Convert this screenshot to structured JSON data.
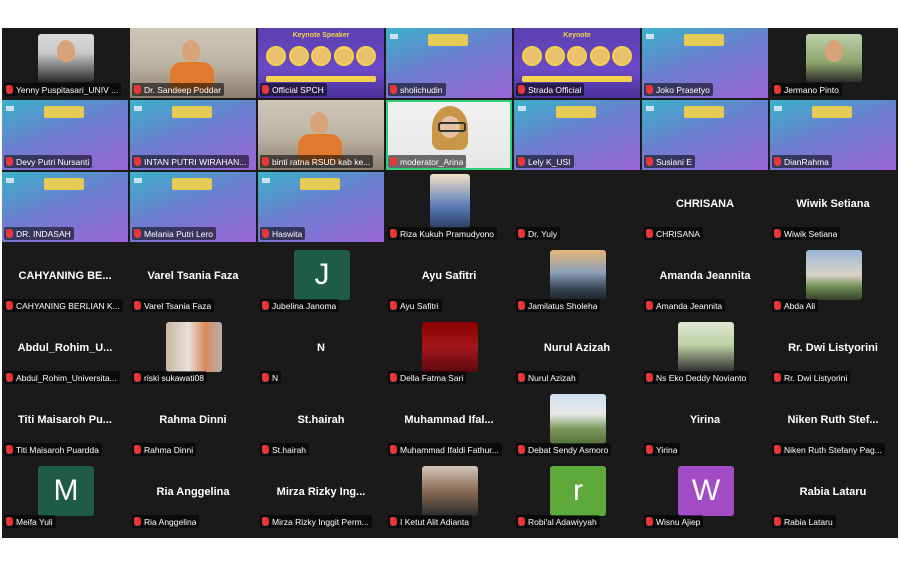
{
  "colors": {
    "accent_active": "#2fd07a",
    "muted_mic": "#e03a3a",
    "grid_bg": "#1a1a1a"
  },
  "participants": [
    {
      "name": "Yenny Puspitasari_UNIV ...",
      "bg": "woman-photo"
    },
    {
      "name": "Dr. Sandeep Poddar",
      "bg": "room-photo"
    },
    {
      "name": "Official SPCH",
      "bg": "poster",
      "heading": "Keynote Speaker"
    },
    {
      "name": "sholichudin",
      "bg": "purple"
    },
    {
      "name": "Strada Official",
      "bg": "poster",
      "heading": "Keynote"
    },
    {
      "name": "Joko Prasetyo",
      "bg": "purple"
    },
    {
      "name": "Jermano Pinto",
      "bg": "man-photo"
    },
    {
      "name": "Devy Putri Nursanti",
      "bg": "purple"
    },
    {
      "name": "INTAN PUTRI WIRAHAN...",
      "bg": "purple"
    },
    {
      "name": "binti ratna RSUD kab ke...",
      "bg": "room-photo"
    },
    {
      "name": "moderator_Arina",
      "bg": "hijab",
      "active": true
    },
    {
      "name": "Lely K_USI",
      "bg": "purple"
    },
    {
      "name": "Susiani E",
      "bg": "purple"
    },
    {
      "name": "DianRahma",
      "bg": "purple"
    },
    {
      "name": "DR. INDASAH",
      "bg": "purple"
    },
    {
      "name": "Melania Putri Lero",
      "bg": "purple"
    },
    {
      "name": "Haswita",
      "bg": "purple"
    },
    {
      "name": "Riza Kukuh Pramudyono",
      "bg": "cartoon"
    },
    {
      "name": "Dr. Yuly",
      "bg": "dark"
    },
    {
      "name": "CHRISANA",
      "bg": "dark",
      "label": "CHRISANA"
    },
    {
      "name": "Wiwik Setiana",
      "bg": "dark",
      "label": "Wiwik Setiana"
    },
    {
      "name": "CAHYANING BERLIAN K...",
      "bg": "dark",
      "label": "CAHYANING BE..."
    },
    {
      "name": "Varel Tsania Faza",
      "bg": "dark",
      "label": "Varel Tsania Faza"
    },
    {
      "name": "Jubelina Janoma",
      "bg": "initial",
      "initial": "J",
      "color": "#1f5b49"
    },
    {
      "name": "Ayu Safitri",
      "bg": "dark",
      "label": "Ayu Safitri"
    },
    {
      "name": "Jamilatus Sholeha",
      "bg": "sunset"
    },
    {
      "name": "Amanda Jeannita",
      "bg": "dark",
      "label": "Amanda Jeannita"
    },
    {
      "name": "Abda Ali",
      "bg": "mountain"
    },
    {
      "name": "Abdul_Rohim_Universita...",
      "bg": "dark",
      "label": "Abdul_Rohim_U..."
    },
    {
      "name": "riski sukawati08",
      "bg": "shelf"
    },
    {
      "name": "N",
      "bg": "dark",
      "label": "N"
    },
    {
      "name": "Della Fatma Sari",
      "bg": "redphoto"
    },
    {
      "name": "Nurul Azizah",
      "bg": "dark",
      "label": "Nurul Azizah"
    },
    {
      "name": "Ns Eko Deddy Novianto",
      "bg": "portrait-man"
    },
    {
      "name": "Rr. Dwi Listyorini",
      "bg": "dark",
      "label": "Rr. Dwi Listyorini"
    },
    {
      "name": "Titi Maisaroh Puardda",
      "bg": "dark",
      "label": "Titi Maisaroh Pu..."
    },
    {
      "name": "Rahma Dinni",
      "bg": "dark",
      "label": "Rahma Dinni"
    },
    {
      "name": "St.hairah",
      "bg": "dark",
      "label": "St.hairah"
    },
    {
      "name": "Muhammad Ifaldi Fathur...",
      "bg": "dark",
      "label": "Muhammad Ifal..."
    },
    {
      "name": "Debat Sendy Asmoro",
      "bg": "park"
    },
    {
      "name": "Yirina",
      "bg": "dark",
      "label": "Yirina"
    },
    {
      "name": "Niken Ruth Stefany Pag...",
      "bg": "dark",
      "label": "Niken Ruth Stef..."
    },
    {
      "name": "Meifa Yuli",
      "bg": "initial",
      "initial": "M",
      "color": "#1f5b49"
    },
    {
      "name": "Ria Anggelina",
      "bg": "dark",
      "label": "Ria Anggelina"
    },
    {
      "name": "Mirza Rizky Inggit Perm...",
      "bg": "dark",
      "label": "Mirza Rizky Ing..."
    },
    {
      "name": "I Ketut Alit Adianta",
      "bg": "beard-man"
    },
    {
      "name": "Robi'al Adawiyyah",
      "bg": "initial",
      "initial": "r",
      "color": "#5da93a"
    },
    {
      "name": "Wisnu Ajiep",
      "bg": "initial",
      "initial": "W",
      "color": "#a14cc4"
    },
    {
      "name": "Rabia Lataru",
      "bg": "dark",
      "label": "Rabia Lataru"
    }
  ]
}
